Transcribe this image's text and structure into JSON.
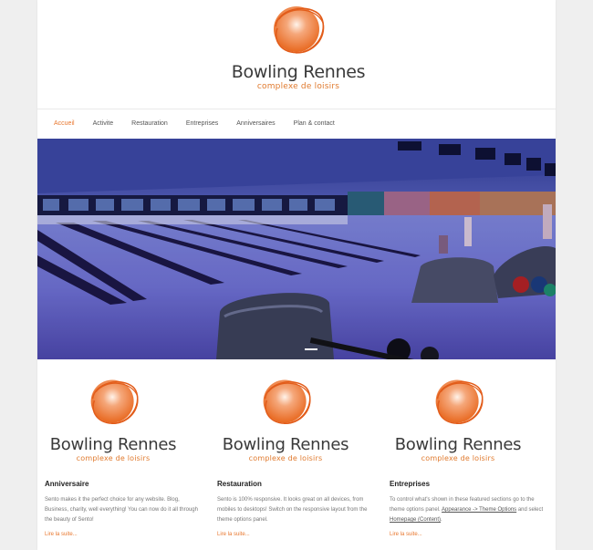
{
  "brand": {
    "title": "Bowling Rennes",
    "subtitle": "complexe de loisirs",
    "logo_icon": "orange-swirl-circle-logo",
    "accent": "#e8772e"
  },
  "nav": {
    "items": [
      {
        "label": "Accueil",
        "active": true
      },
      {
        "label": "Activite"
      },
      {
        "label": "Restauration"
      },
      {
        "label": "Entreprises"
      },
      {
        "label": "Anniversaires"
      },
      {
        "label": "Plan & contact"
      }
    ]
  },
  "hero": {
    "image_alt": "bowling alley lanes photo"
  },
  "features": [
    {
      "title": "Anniversaire",
      "text": "Sento makes it the perfect choice for any website. Blog, Business, charity, well everything! You can now do it all through the beauty of Sento!",
      "more": "Lire la suite..."
    },
    {
      "title": "Restauration",
      "text": "Sento is 100% responsive. It looks great on all devices, from mobiles to desktops! Switch on the responsive layout from the theme options panel.",
      "more": "Lire la suite..."
    },
    {
      "title": "Entreprises",
      "text_parts": {
        "pre": "To control what's shown in these featured sections go to the theme options panel. ",
        "link1": "Appearance -> Theme Options",
        "mid": " and select ",
        "link2": "Homepage (Content)",
        "post": "."
      },
      "more": "Lire la suite..."
    }
  ]
}
